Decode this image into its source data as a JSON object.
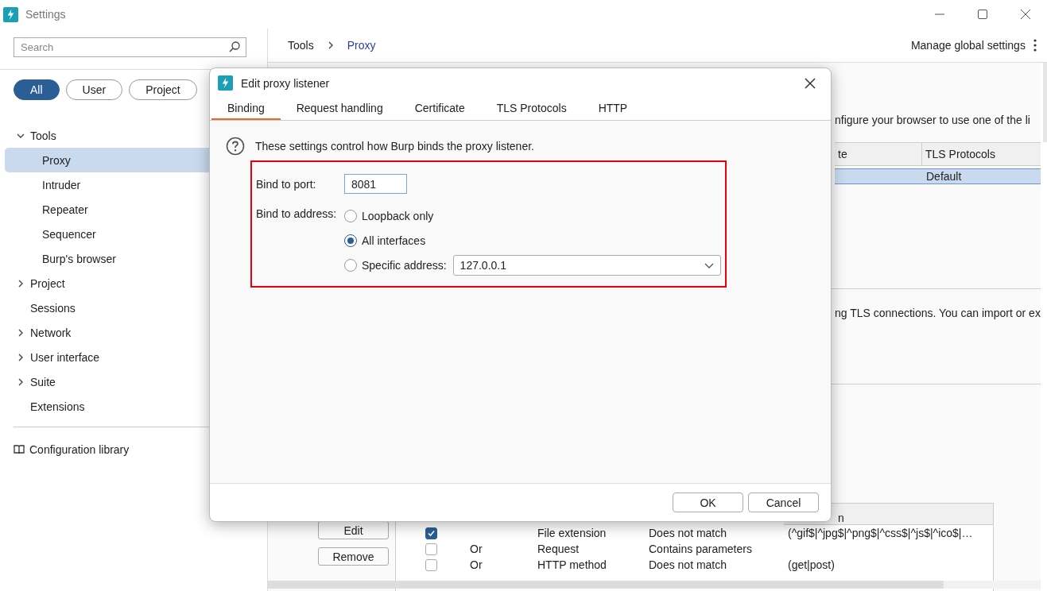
{
  "window": {
    "title": "Settings"
  },
  "sidebar": {
    "search": {
      "placeholder": "Search"
    },
    "filters": [
      {
        "label": "All",
        "selected": true
      },
      {
        "label": "User",
        "selected": false
      },
      {
        "label": "Project",
        "selected": false
      }
    ],
    "tree": [
      {
        "label": "Tools",
        "kind": "folder",
        "expanded": true,
        "selected": false,
        "children": [
          {
            "label": "Proxy",
            "kind": "page",
            "selected": true
          },
          {
            "label": "Intruder",
            "kind": "page",
            "selected": false
          },
          {
            "label": "Repeater",
            "kind": "page",
            "selected": false
          },
          {
            "label": "Sequencer",
            "kind": "page",
            "selected": false
          },
          {
            "label": "Burp's browser",
            "kind": "page",
            "selected": false
          }
        ]
      },
      {
        "label": "Project",
        "kind": "folder",
        "expanded": false,
        "selected": false
      },
      {
        "label": "Sessions",
        "kind": "page",
        "selected": false
      },
      {
        "label": "Network",
        "kind": "folder",
        "expanded": false,
        "selected": false
      },
      {
        "label": "User interface",
        "kind": "folder",
        "expanded": false,
        "selected": false
      },
      {
        "label": "Suite",
        "kind": "folder",
        "expanded": false,
        "selected": false
      },
      {
        "label": "Extensions",
        "kind": "page",
        "selected": false
      }
    ],
    "config_library": "Configuration library"
  },
  "header": {
    "breadcrumb": [
      "Tools",
      "Proxy"
    ],
    "manage": "Manage global settings"
  },
  "listeners": {
    "description": "nfigure your browser to use one of the li",
    "columns": [
      "te",
      "TLS Protocols"
    ],
    "rows": [
      {
        "tls": "Default",
        "selected": true
      }
    ]
  },
  "ca_section": {
    "description": "ng TLS connections. You can import or ex"
  },
  "interception": {
    "buttons": [
      "Edit",
      "Remove"
    ],
    "last_column_header": "n",
    "rows": [
      {
        "enabled": true,
        "match_type": "File extension",
        "relationship": "Does not match",
        "condition": "(^gif$|^jpg$|^png$|^css$|^js$|^ico$|…"
      },
      {
        "enabled": false,
        "operator": "Or",
        "match_type": "Request",
        "relationship": "Contains parameters"
      },
      {
        "enabled": false,
        "operator": "Or",
        "match_type": "HTTP method",
        "relationship": "Does not match",
        "condition": "(get|post)"
      }
    ]
  },
  "dialog": {
    "title": "Edit proxy listener",
    "tabs": [
      {
        "label": "Binding",
        "selected": true
      },
      {
        "label": "Request handling",
        "selected": false
      },
      {
        "label": "Certificate",
        "selected": false
      },
      {
        "label": "TLS Protocols",
        "selected": false
      },
      {
        "label": "HTTP",
        "selected": false
      }
    ],
    "info": "These settings control how Burp binds the proxy listener.",
    "highlight": true,
    "port_label": "Bind to port:",
    "port": "8081",
    "address_label": "Bind to address:",
    "options": [
      {
        "label": "Loopback only",
        "kind": "plain",
        "selected": false
      },
      {
        "label": "All interfaces",
        "kind": "plain",
        "selected": true
      },
      {
        "label": "Specific address:",
        "kind": "address",
        "selected": false,
        "value": "127.0.0.1"
      }
    ],
    "buttons": [
      "OK",
      "Cancel"
    ]
  }
}
